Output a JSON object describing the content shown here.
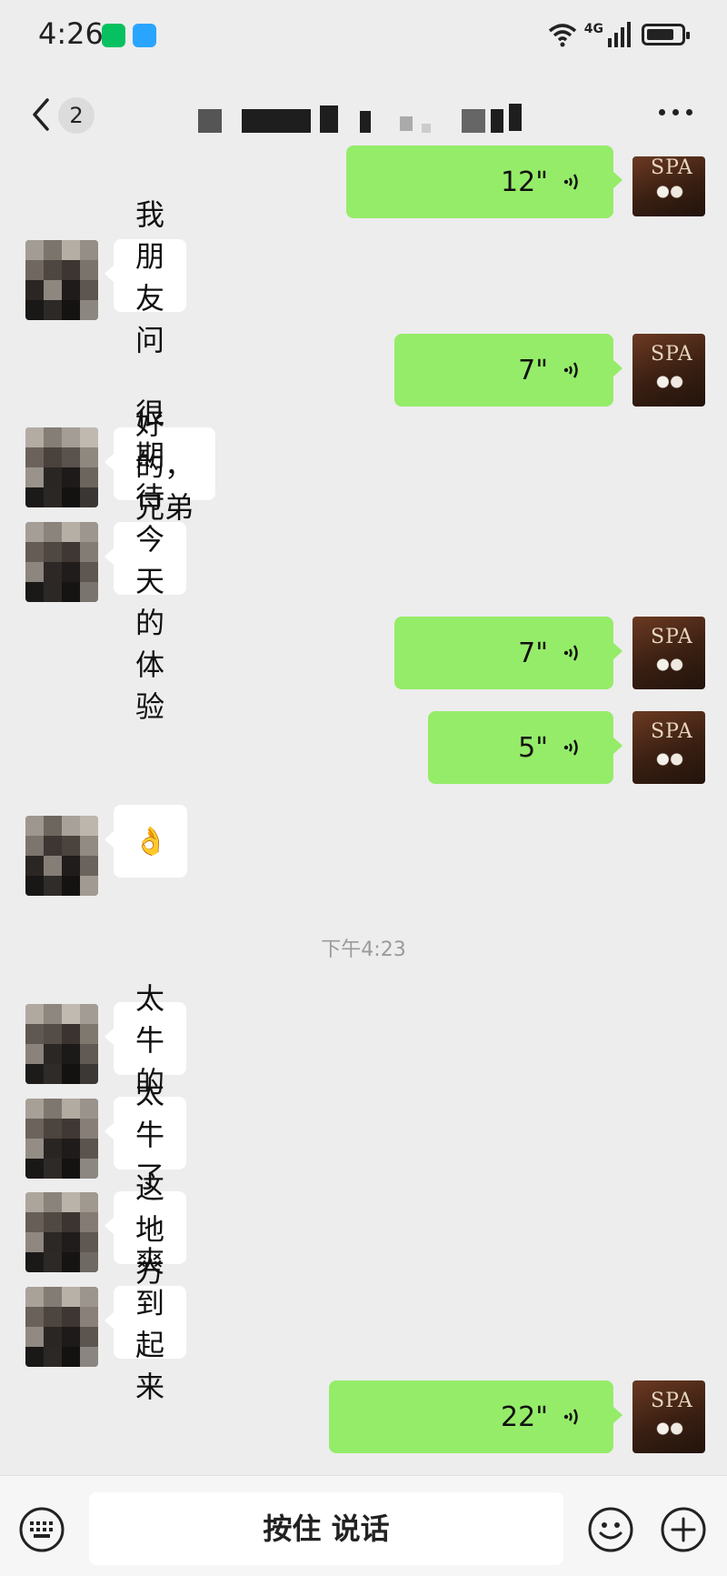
{
  "status_bar": {
    "time": "4:26",
    "network": "4G",
    "icons": [
      "wechat-notification-icon",
      "message-notification-icon",
      "wifi-icon",
      "signal-icon",
      "battery-icon"
    ],
    "battery_level": 0.8
  },
  "header": {
    "back_icon": "chevron-left-icon",
    "unread_count": "2",
    "title": "",
    "more_icon": "more-icon"
  },
  "colors": {
    "background": "#ededed",
    "incoming_bubble": "#ffffff",
    "outgoing_bubble": "#95ec69"
  },
  "messages": [
    {
      "side": "out",
      "type": "voice",
      "duration": "12\""
    },
    {
      "side": "in",
      "type": "text",
      "text": "我朋友问"
    },
    {
      "side": "out",
      "type": "voice",
      "duration": "7\""
    },
    {
      "side": "in",
      "type": "text",
      "text": "好的，兄弟"
    },
    {
      "side": "in",
      "type": "text",
      "text": "很期待今天的体验"
    },
    {
      "side": "out",
      "type": "voice",
      "duration": "7\""
    },
    {
      "side": "out",
      "type": "voice",
      "duration": "5\""
    },
    {
      "side": "in",
      "type": "emoji",
      "text": "👌"
    },
    {
      "side": "in",
      "type": "text",
      "text": "太牛的"
    },
    {
      "side": "in",
      "type": "text",
      "text": "太牛了"
    },
    {
      "side": "in",
      "type": "text",
      "text": "这地方"
    },
    {
      "side": "in",
      "type": "text",
      "text": "爽到起来"
    },
    {
      "side": "out",
      "type": "voice",
      "duration": "22\""
    }
  ],
  "timestamp": "下午4:23",
  "outgoing_avatar_text": "SPA",
  "input_bar": {
    "hold_to_talk_label": "按住 说话",
    "icons": [
      "keyboard-icon",
      "emoji-icon",
      "plus-icon"
    ]
  }
}
